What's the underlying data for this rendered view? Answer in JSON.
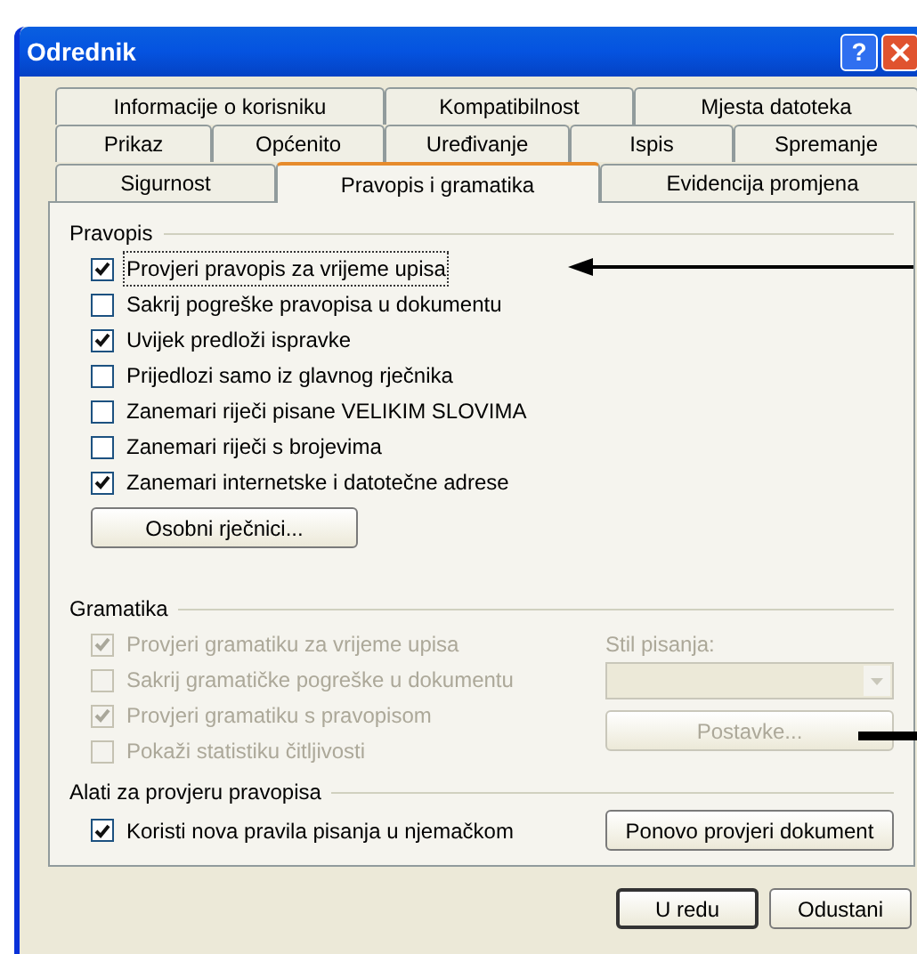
{
  "window": {
    "title": "Odrednik",
    "help_button": "?"
  },
  "tabs": [
    [
      {
        "label": "Informacije o korisniku",
        "selected": false
      },
      {
        "label": "Kompatibilnost",
        "selected": false
      },
      {
        "label": "Mjesta datoteka",
        "selected": false
      }
    ],
    [
      {
        "label": "Prikaz",
        "selected": false
      },
      {
        "label": "Općenito",
        "selected": false
      },
      {
        "label": "Uređivanje",
        "selected": false
      },
      {
        "label": "Ispis",
        "selected": false
      },
      {
        "label": "Spremanje",
        "selected": false
      }
    ],
    [
      {
        "label": "Sigurnost",
        "selected": false
      },
      {
        "label": "Pravopis i gramatika",
        "selected": true
      },
      {
        "label": "Evidencija promjena",
        "selected": false
      }
    ]
  ],
  "spelling": {
    "title": "Pravopis",
    "options": [
      {
        "label": "Provjeri pravopis za vrijeme upisa",
        "checked": true,
        "focused": true
      },
      {
        "label": "Sakrij pogreške pravopisa u dokumentu",
        "checked": false,
        "focused": false
      },
      {
        "label": "Uvijek predloži ispravke",
        "checked": true,
        "focused": false
      },
      {
        "label": "Prijedlozi samo iz glavnog rječnika",
        "checked": false,
        "focused": false
      },
      {
        "label": "Zanemari riječi pisane VELIKIM SLOVIMA",
        "checked": false,
        "focused": false
      },
      {
        "label": "Zanemari riječi s brojevima",
        "checked": false,
        "focused": false
      },
      {
        "label": "Zanemari internetske i datotečne adrese",
        "checked": true,
        "focused": false
      }
    ],
    "button": "Osobni rječnici..."
  },
  "grammar": {
    "title": "Gramatika",
    "options": [
      {
        "label": "Provjeri gramatiku za vrijeme upisa",
        "checked": true,
        "disabled": true
      },
      {
        "label": "Sakrij gramatičke pogreške u dokumentu",
        "checked": false,
        "disabled": true
      },
      {
        "label": "Provjeri gramatiku s pravopisom",
        "checked": true,
        "disabled": true
      },
      {
        "label": "Pokaži statistiku čitljivosti",
        "checked": false,
        "disabled": true
      }
    ],
    "style_label": "Stil pisanja:",
    "style_dropdown": {
      "disabled": true
    },
    "button": {
      "label": "Postavke...",
      "disabled": true
    }
  },
  "tools": {
    "title": "Alati za provjeru pravopisa",
    "options": [
      {
        "label": "Koristi nova pravila pisanja u njemačkom",
        "checked": true,
        "disabled": false
      }
    ],
    "button": "Ponovo provjeri dokument"
  },
  "buttons": [
    {
      "label": "U redu",
      "kind": "default"
    },
    {
      "label": "Odustani",
      "kind": "normal"
    }
  ]
}
